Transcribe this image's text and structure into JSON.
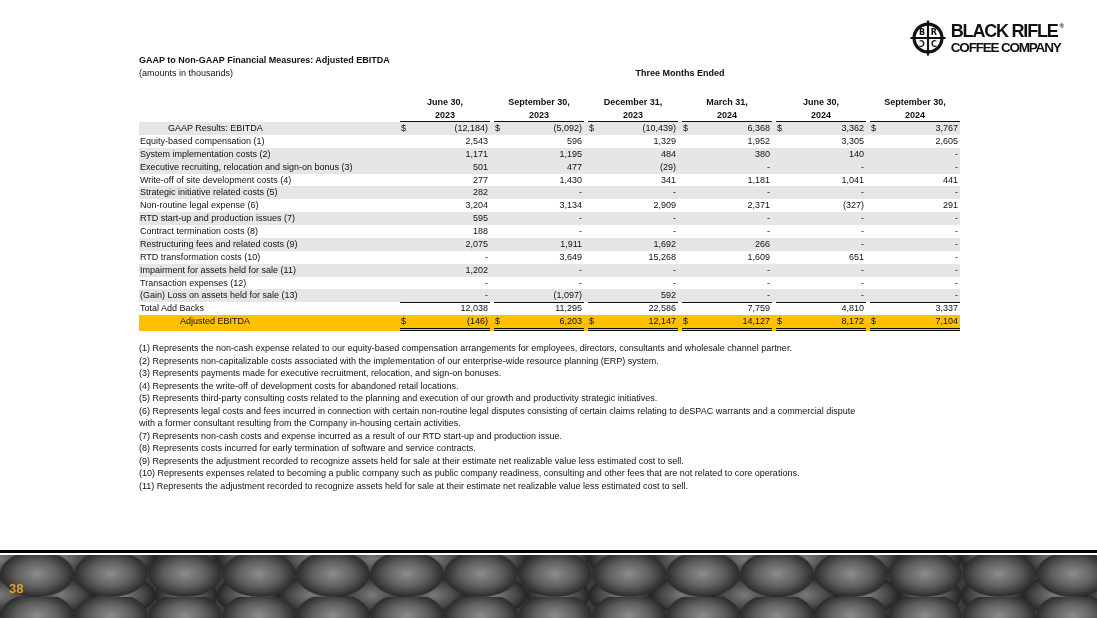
{
  "logo": {
    "emblem_letters": [
      "B",
      "R",
      "Ↄ",
      "C"
    ],
    "name": "BLACK RIFLE$^{®}$",
    "subtitle": "COFFEE COMPANY"
  },
  "report": {
    "title": "GAAP to Non-GAAP Financial Measures: Adjusted EBITDA",
    "subtitle": "(amounts in thousands)",
    "period_heading": "Three Months Ended"
  },
  "table": {
    "columns": [
      {
        "date": "June 30,",
        "year": "2023"
      },
      {
        "date": "September 30,",
        "year": "2023"
      },
      {
        "date": "December 31,",
        "year": "2023"
      },
      {
        "date": "March 31,",
        "year": "2024"
      },
      {
        "date": "June 30,",
        "year": "2024"
      },
      {
        "date": "September 30,",
        "year": "2024"
      }
    ],
    "rows": [
      {
        "kind": "result",
        "label": "GAAP Results: EBITDA",
        "shaded": true,
        "cells": [
          {
            "currency": "$",
            "amount": "(12,184)"
          },
          {
            "currency": "$",
            "amount": "(5,092)"
          },
          {
            "currency": "$",
            "amount": "(10,439)"
          },
          {
            "currency": "$",
            "amount": "6,368"
          },
          {
            "currency": "$",
            "amount": "3,362"
          },
          {
            "currency": "$",
            "amount": "3,767"
          }
        ]
      },
      {
        "kind": "item",
        "label": "Equity-based compensation (1)",
        "shaded": false,
        "cells": [
          {
            "amount": "2,543"
          },
          {
            "amount": "596"
          },
          {
            "amount": "1,329"
          },
          {
            "amount": "1,952"
          },
          {
            "amount": "3,305"
          },
          {
            "amount": "2,605"
          }
        ]
      },
      {
        "kind": "item",
        "label": "System implementation costs (2)",
        "shaded": true,
        "cells": [
          {
            "amount": "1,171"
          },
          {
            "amount": "1,195"
          },
          {
            "amount": "484"
          },
          {
            "amount": "380"
          },
          {
            "amount": "140"
          },
          {
            "amount": "-"
          }
        ]
      },
      {
        "kind": "item",
        "label": "Executive recruiting, relocation and sign-on bonus (3)",
        "shaded": true,
        "cells": [
          {
            "amount": "501"
          },
          {
            "amount": "477"
          },
          {
            "amount": "(29)"
          },
          {
            "amount": "-"
          },
          {
            "amount": "-"
          },
          {
            "amount": "-"
          }
        ]
      },
      {
        "kind": "item",
        "label": "Write-off of site development costs (4)",
        "shaded": false,
        "cells": [
          {
            "amount": "277"
          },
          {
            "amount": "1,430"
          },
          {
            "amount": "341"
          },
          {
            "amount": "1,181"
          },
          {
            "amount": "1,041"
          },
          {
            "amount": "441"
          }
        ]
      },
      {
        "kind": "item",
        "label": "Strategic initiative related costs (5)",
        "shaded": true,
        "cells": [
          {
            "amount": "282"
          },
          {
            "amount": "-"
          },
          {
            "amount": "-"
          },
          {
            "amount": "-"
          },
          {
            "amount": "-"
          },
          {
            "amount": "-"
          }
        ]
      },
      {
        "kind": "item",
        "label": "Non-routine legal expense (6)",
        "shaded": false,
        "cells": [
          {
            "amount": "3,204"
          },
          {
            "amount": "3,134"
          },
          {
            "amount": "2,909"
          },
          {
            "amount": "2,371"
          },
          {
            "amount": "(327)"
          },
          {
            "amount": "291"
          }
        ]
      },
      {
        "kind": "item",
        "label": "RTD start-up and production issues (7)",
        "shaded": true,
        "cells": [
          {
            "amount": "595"
          },
          {
            "amount": "-"
          },
          {
            "amount": "-"
          },
          {
            "amount": "-"
          },
          {
            "amount": "-"
          },
          {
            "amount": "-"
          }
        ]
      },
      {
        "kind": "item",
        "label": "Contract termination costs (8)",
        "shaded": false,
        "cells": [
          {
            "amount": "188"
          },
          {
            "amount": "-"
          },
          {
            "amount": "-"
          },
          {
            "amount": "-"
          },
          {
            "amount": "-"
          },
          {
            "amount": "-"
          }
        ]
      },
      {
        "kind": "item",
        "label": "Restructuring fees and related costs (9)",
        "shaded": true,
        "cells": [
          {
            "amount": "2,075"
          },
          {
            "amount": "1,911"
          },
          {
            "amount": "1,692"
          },
          {
            "amount": "266"
          },
          {
            "amount": "-"
          },
          {
            "amount": "-"
          }
        ]
      },
      {
        "kind": "item",
        "label": "RTD transformation costs (10)",
        "shaded": false,
        "cells": [
          {
            "amount": "-"
          },
          {
            "amount": "3,649"
          },
          {
            "amount": "15,268"
          },
          {
            "amount": "1,609"
          },
          {
            "amount": "651"
          },
          {
            "amount": "-"
          }
        ]
      },
      {
        "kind": "item",
        "label": "Impairment for assets held for sale (11)",
        "shaded": true,
        "cells": [
          {
            "amount": "1,202"
          },
          {
            "amount": "-"
          },
          {
            "amount": "-"
          },
          {
            "amount": "-"
          },
          {
            "amount": "-"
          },
          {
            "amount": "-"
          }
        ]
      },
      {
        "kind": "item",
        "label": "Transaction expenses (12)",
        "shaded": false,
        "cells": [
          {
            "amount": "-"
          },
          {
            "amount": "-"
          },
          {
            "amount": "-"
          },
          {
            "amount": "-"
          },
          {
            "amount": "-"
          },
          {
            "amount": "-"
          }
        ]
      },
      {
        "kind": "item",
        "label": "(Gain) Loss on assets held for sale (13)",
        "shaded": true,
        "cells": [
          {
            "amount": "-"
          },
          {
            "amount": "(1,097)"
          },
          {
            "amount": "592"
          },
          {
            "amount": "-"
          },
          {
            "amount": "-"
          },
          {
            "amount": "-"
          }
        ]
      },
      {
        "kind": "total",
        "label": "Total Add Backs",
        "shaded": false,
        "cells": [
          {
            "amount": "12,038"
          },
          {
            "amount": "11,295"
          },
          {
            "amount": "22,586"
          },
          {
            "amount": "7,759"
          },
          {
            "amount": "4,810"
          },
          {
            "amount": "3,337"
          }
        ]
      },
      {
        "kind": "adjusted",
        "label": "Adjusted EBITDA",
        "cells": [
          {
            "currency": "$",
            "amount": "(146)"
          },
          {
            "currency": "$",
            "amount": "6,203"
          },
          {
            "currency": "$",
            "amount": "12,147"
          },
          {
            "currency": "$",
            "amount": "14,127"
          },
          {
            "currency": "$",
            "amount": "8,172"
          },
          {
            "currency": "$",
            "amount": "7,104"
          }
        ]
      }
    ]
  },
  "footnotes": [
    "(1) Represents the non-cash expense related to our equity-based compensation arrangements for employees, directors, consultants and wholesale channel partner.",
    "(2) Represents non-capitalizable costs associated with the implementation of our enterprise-wide resource planning (ERP) system.",
    "(3) Represents payments made for executive recruitment, relocation, and sign-on bonuses.",
    "(4) Represents the write-off of development costs for abandoned retail locations.",
    "(5) Represents third-party consulting costs related to the planning and execution of our growth and productivity strategic initiatives.",
    "(6) Represents legal costs and fees incurred in connection with certain non-routine legal disputes consisting of certain claims relating to deSPAC warrants and a commercial dispute with a former consultant resulting from the Company in-housing certain activities.",
    "(7) Represents non-cash costs and expense incurred as a result of our RTD start-up and production issue.",
    "(8) Represents costs incurred for early termination of software and service contracts.",
    "(9) Represents the adjustment recorded to recognize assets held for sale at their estimate net realizable value less estimated cost to sell.",
    "(10) Represents expenses related to becoming a public company such as public company readiness, consulting and other fees that are not related to core operations.",
    "(11) Represents the adjustment recorded to recognize assets held for sale at their estimate net realizable value less estimated cost to sell."
  ],
  "footer": {
    "page_number": "38"
  }
}
